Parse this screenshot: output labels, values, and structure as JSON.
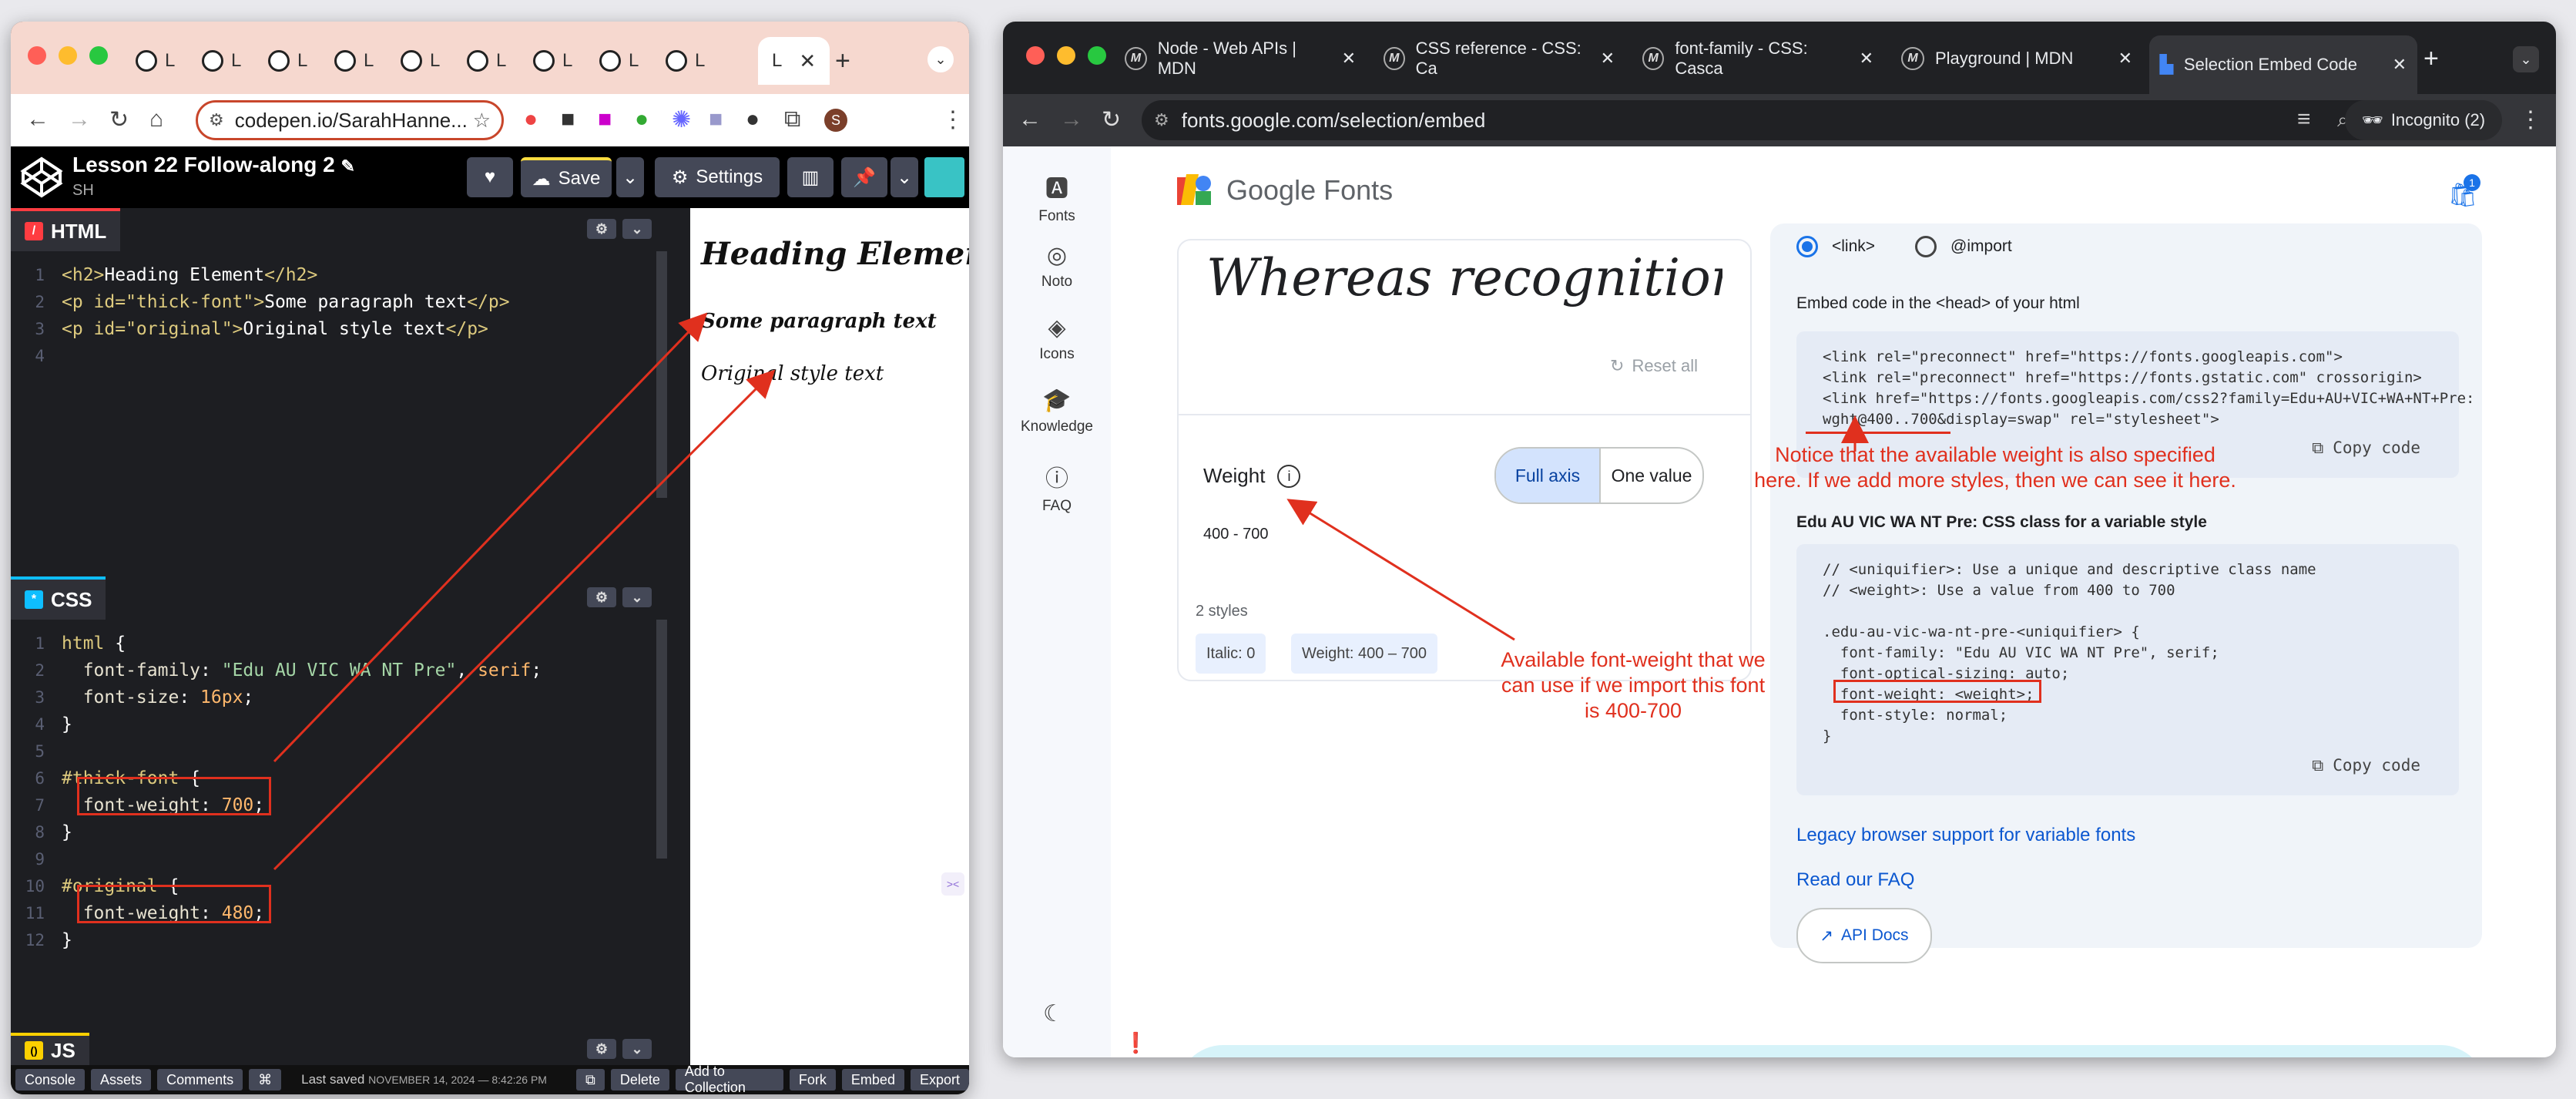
{
  "left_window": {
    "tab_label_short": "L",
    "tab_active_label": "L",
    "url": "codepen.io/SarahHanne...",
    "pen_title": "Lesson 22 Follow-along 2",
    "pen_author": "SH",
    "save_label": "Save",
    "settings_label": "Settings",
    "html_pane": {
      "title": "HTML",
      "line_numbers": [
        "1",
        "2",
        "3",
        "4"
      ],
      "lines": [
        [
          "<h2>",
          "Heading Element",
          "</h2>"
        ],
        [
          "<p id=\"thick-font\">",
          "Some paragraph text",
          "</p>"
        ],
        [
          "<p id=\"original\">",
          "Original style text",
          "</p>"
        ]
      ]
    },
    "css_pane": {
      "title": "CSS",
      "line_numbers": [
        "1",
        "2",
        "3",
        "4",
        "5",
        "6",
        "7",
        "8",
        "9",
        "10",
        "11",
        "12"
      ],
      "l1_sel": "html",
      "l1_brace": " {",
      "l2_prop": "  font-family",
      "l2_val": "\"Edu AU VIC WA NT Pre\"",
      "l2_sep": ", ",
      "l2_kw": "serif",
      "l2_end": ";",
      "l3_prop": "  font-size",
      "l3_val": "16px",
      "l3_end": ";",
      "close": "}",
      "l6_sel": "#thick-font",
      "l6_brace": " {",
      "l7_prop": "  font-weight",
      "l7_val": "700",
      "l7_end": ";",
      "l10_sel": "#original",
      "l10_brace": " {",
      "l11_prop": "  font-weight",
      "l11_val": "480",
      "l11_end": ";"
    },
    "js_pane": {
      "title": "JS"
    },
    "preview": {
      "heading": "Heading Element",
      "thick": "Some paragraph text",
      "original": "Original style text"
    },
    "bottom_bar": {
      "console": "Console",
      "assets": "Assets",
      "comments": "Comments",
      "shortcut": "⌘",
      "last_saved_label": "Last saved",
      "last_saved_date": "NOVEMBER 14, 2024 — 8:42:26 PM",
      "delete": "Delete",
      "add_to_collection": "Add to Collection",
      "fork": "Fork",
      "embed": "Embed",
      "export": "Export"
    }
  },
  "right_window": {
    "tabs": [
      {
        "label": "Node - Web APIs | MDN"
      },
      {
        "label": "CSS reference - CSS: Ca"
      },
      {
        "label": "font-family - CSS: Casca"
      },
      {
        "label": "Playground | MDN"
      },
      {
        "label": "Selection Embed Code"
      }
    ],
    "url": "fonts.google.com/selection/embed",
    "incognito": "Incognito (2)",
    "logo_text": "Google Fonts",
    "cart_badge": "1",
    "nav": [
      {
        "label": "Fonts"
      },
      {
        "label": "Noto"
      },
      {
        "label": "Icons"
      },
      {
        "label": "Knowledge"
      },
      {
        "label": "FAQ"
      }
    ],
    "preview_text": "Whereas recognition of th",
    "reset_all": "Reset all",
    "weight_label": "Weight",
    "full_axis": "Full axis",
    "one_value": "One value",
    "weight_range": "400 - 700",
    "styles_count": "2 styles",
    "chip_italic": "Italic: 0",
    "chip_weight": "Weight: 400 – 700",
    "radio_link": "<link>",
    "radio_import": "@import",
    "embed_head_label": "Embed code in the <head> of your html",
    "embed_code_lines": [
      "<link rel=\"preconnect\" href=\"https://fonts.googleapis.com\">",
      "<link rel=\"preconnect\" href=\"https://fonts.gstatic.com\" crossorigin>",
      "<link href=\"https://fonts.googleapis.com/css2?family=Edu+AU+VIC+WA+NT+Pre:",
      "wght@400..700&display=swap\" rel=\"stylesheet\">"
    ],
    "copy_code": "Copy code",
    "css_class_label": "Edu AU VIC WA NT Pre: CSS class for a variable style",
    "css_code_lines": [
      "// <uniquifier>: Use a unique and descriptive class name",
      "// <weight>: Use a value from 400 to 700",
      "",
      ".edu-au-vic-wa-nt-pre-<uniquifier> {",
      "  font-family: \"Edu AU VIC WA NT Pre\", serif;",
      "  font-optical-sizing: auto;",
      "  font-weight: <weight>;",
      "  font-style: normal;",
      "}"
    ],
    "legacy_link": "Legacy browser support for variable fonts",
    "faq_link": "Read our FAQ",
    "api_docs": "API Docs"
  },
  "annotations": {
    "notice": "Notice that the available weight is also specified here. If we add more styles, then we can see it here.",
    "available": "Available font-weight that we can use if we import this font is 400-700"
  },
  "colors": {
    "annotation": "#e0301e",
    "codepen_green": "#47cf73",
    "google_blue": "#1a73e8"
  }
}
